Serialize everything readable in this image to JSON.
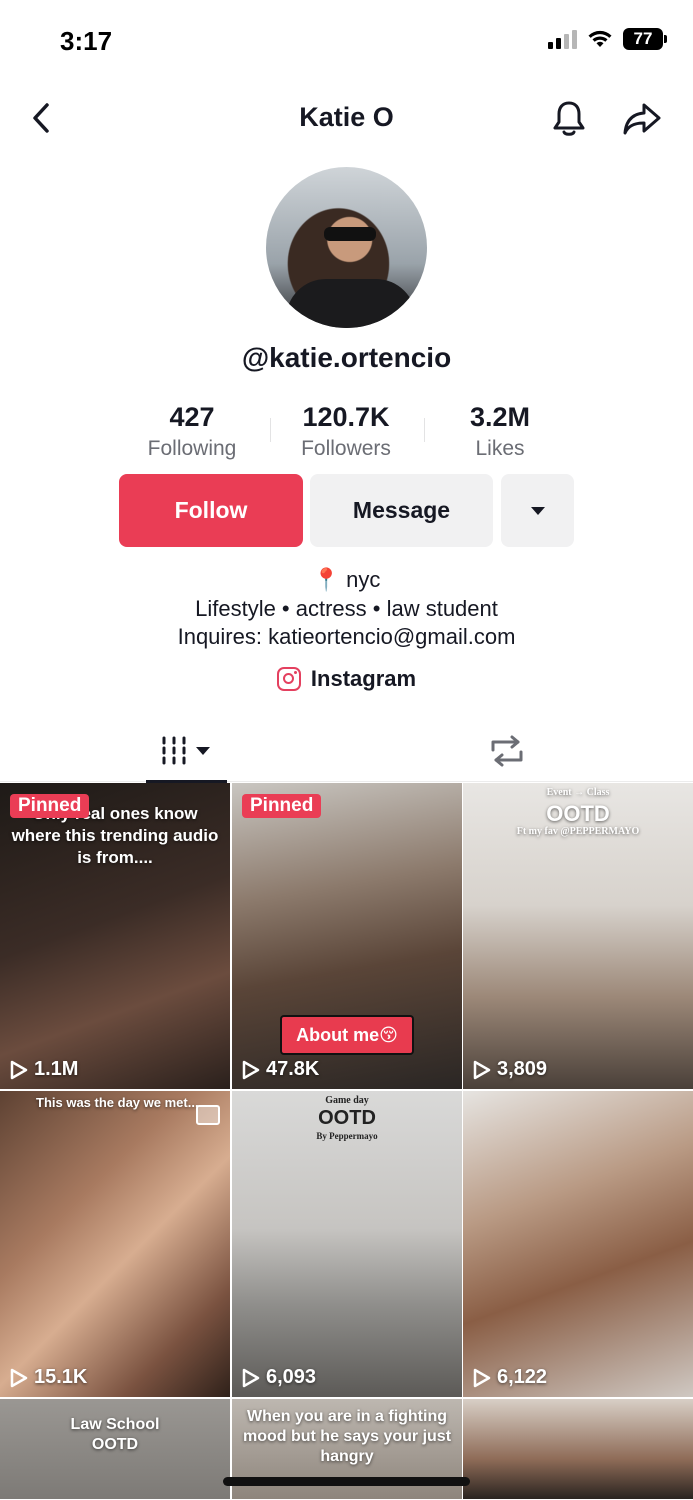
{
  "status": {
    "time": "3:17",
    "battery": "77"
  },
  "nav": {
    "title": "Katie O",
    "back_icon": "chevron-left-icon",
    "bell_icon": "bell-icon",
    "share_icon": "share-arrow-icon"
  },
  "profile": {
    "username": "@katie.ortencio"
  },
  "stats": [
    {
      "num": "427",
      "label": "Following"
    },
    {
      "num": "120.7K",
      "label": "Followers"
    },
    {
      "num": "3.2M",
      "label": "Likes"
    }
  ],
  "buttons": {
    "follow": "Follow",
    "message": "Message"
  },
  "bio": {
    "location": "nyc",
    "line2": "Lifestyle • actress • law student",
    "line3": "Inquires: katieortencio@gmail.com",
    "instagram": "Instagram"
  },
  "colors": {
    "accent": "#ea3d55",
    "secondary_btn": "#f1f1f2",
    "text": "#161823",
    "muted": "#6b6d74"
  },
  "videos": [
    {
      "pinned": "Pinned",
      "caption": "Only real ones know where this trending audio is from....",
      "views": "1.1M"
    },
    {
      "pinned": "Pinned",
      "sticker": "About me😚",
      "views": "47.8K"
    },
    {
      "caption_top": "Event → Class",
      "caption_main": "OOTD",
      "caption_sub": "Ft my fav @PEPPERMAYO",
      "views": "3,809"
    },
    {
      "caption": "This was the day we met...",
      "views": "15.1K"
    },
    {
      "caption_top": "Game day",
      "caption_main": "OOTD",
      "caption_sub": "By Peppermayo",
      "views": "6,093"
    },
    {
      "views": "6,122"
    },
    {
      "caption": "Law School OOTD"
    },
    {
      "caption": "When you are in a fighting mood but he says your just hangry"
    },
    {}
  ]
}
